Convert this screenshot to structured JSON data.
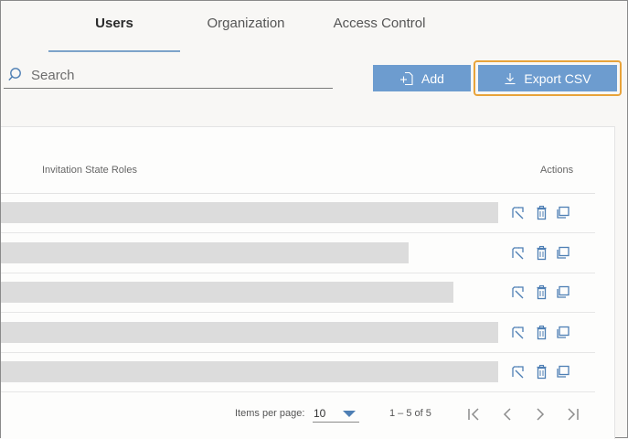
{
  "tabs": [
    {
      "label": "Users",
      "active": true
    },
    {
      "label": "Organization",
      "active": false
    },
    {
      "label": "Access Control",
      "active": false
    }
  ],
  "toolbar": {
    "search_placeholder": "Search",
    "add_label": "Add",
    "export_label": "Export CSV"
  },
  "table": {
    "columns": {
      "roles": "Invitation State Roles",
      "actions": "Actions"
    },
    "rows": [
      {
        "loading_fill": 1.0
      },
      {
        "loading_fill": 0.82
      },
      {
        "loading_fill": 0.91
      },
      {
        "loading_fill": 1.0
      },
      {
        "loading_fill": 1.0
      }
    ],
    "row_actions": [
      "edit-icon",
      "trash-icon",
      "copy-icon"
    ]
  },
  "pagination": {
    "items_per_page_label": "Items per page:",
    "items_per_page_value": "10",
    "range_text": "1 – 5 of 5"
  },
  "colors": {
    "accent": "#6d9ccf",
    "focus": "#e8a33a",
    "placeholder_bar": "#dcdcdc",
    "icon": "#4e7fb4"
  }
}
